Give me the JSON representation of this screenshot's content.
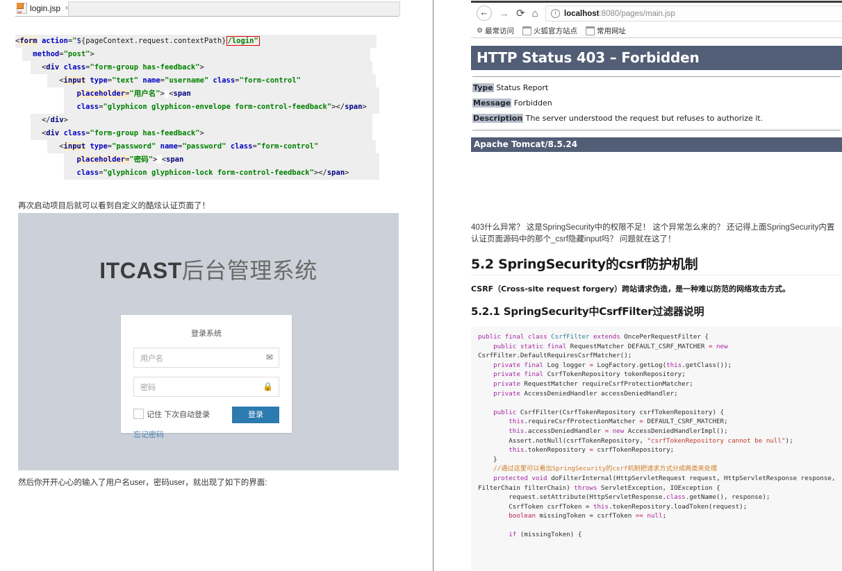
{
  "left": {
    "editor_tab": {
      "icon": "jsp-file-icon",
      "label": "login.jsp",
      "close": "×"
    },
    "jsp_code": {
      "lines": [
        {
          "indent": 0,
          "parts": [
            {
              "t": "<",
              "c": "pl"
            },
            {
              "t": "form",
              "c": "k hl"
            },
            {
              "t": " ",
              "c": "pl"
            },
            {
              "t": "action",
              "c": "at"
            },
            {
              "t": "=",
              "c": "pl"
            },
            {
              "t": "\"",
              "c": "st"
            },
            {
              "t": "$",
              "c": "el"
            },
            {
              "t": "{pageContext.request.contextPath}",
              "c": "pl"
            },
            {
              "t": "/login\"",
              "c": "st boxed"
            }
          ]
        },
        {
          "indent": 2,
          "parts": [
            {
              "t": "method",
              "c": "at"
            },
            {
              "t": "=",
              "c": "pl"
            },
            {
              "t": "\"post\"",
              "c": "st"
            },
            {
              "t": ">",
              "c": "pl"
            }
          ]
        },
        {
          "indent": 3,
          "parts": [
            {
              "t": "<",
              "c": "pl"
            },
            {
              "t": "div",
              "c": "k"
            },
            {
              "t": " ",
              "c": "pl"
            },
            {
              "t": "class",
              "c": "at"
            },
            {
              "t": "=",
              "c": "pl"
            },
            {
              "t": "\"form-group has-feedback\"",
              "c": "st"
            },
            {
              "t": ">",
              "c": "pl"
            }
          ]
        },
        {
          "indent": 5,
          "parts": [
            {
              "t": "<",
              "c": "pl"
            },
            {
              "t": "input",
              "c": "k hl"
            },
            {
              "t": " ",
              "c": "pl"
            },
            {
              "t": "type",
              "c": "at"
            },
            {
              "t": "=",
              "c": "pl"
            },
            {
              "t": "\"text\"",
              "c": "st"
            },
            {
              "t": " ",
              "c": "pl"
            },
            {
              "t": "name",
              "c": "at"
            },
            {
              "t": "=",
              "c": "pl"
            },
            {
              "t": "\"username\"",
              "c": "st"
            },
            {
              "t": " ",
              "c": "pl"
            },
            {
              "t": "class",
              "c": "at"
            },
            {
              "t": "=",
              "c": "pl"
            },
            {
              "t": "\"form-control\"",
              "c": "st"
            }
          ]
        },
        {
          "indent": 7,
          "parts": [
            {
              "t": "placeholder",
              "c": "at hl"
            },
            {
              "t": "=",
              "c": "pl hl"
            },
            {
              "t": "\"用户名\"",
              "c": "st"
            },
            {
              "t": ">",
              "c": "pl"
            },
            {
              "t": " ",
              "c": "pl hl2"
            },
            {
              "t": "<",
              "c": "pl"
            },
            {
              "t": "span",
              "c": "k"
            }
          ]
        },
        {
          "indent": 7,
          "parts": [
            {
              "t": "class",
              "c": "at"
            },
            {
              "t": "=",
              "c": "pl"
            },
            {
              "t": "\"glyphicon glyphicon-envelope form-control-feedback\"",
              "c": "st"
            },
            {
              "t": "></",
              "c": "pl"
            },
            {
              "t": "span",
              "c": "k"
            },
            {
              "t": ">",
              "c": "pl"
            }
          ]
        },
        {
          "indent": 3,
          "parts": [
            {
              "t": "</",
              "c": "pl"
            },
            {
              "t": "div",
              "c": "k"
            },
            {
              "t": ">",
              "c": "pl"
            }
          ]
        },
        {
          "indent": 3,
          "parts": [
            {
              "t": "<",
              "c": "pl"
            },
            {
              "t": "div",
              "c": "k"
            },
            {
              "t": " ",
              "c": "pl"
            },
            {
              "t": "class",
              "c": "at"
            },
            {
              "t": "=",
              "c": "pl"
            },
            {
              "t": "\"form-group has-feedback\"",
              "c": "st"
            },
            {
              "t": ">",
              "c": "pl"
            }
          ]
        },
        {
          "indent": 5,
          "parts": [
            {
              "t": "<",
              "c": "pl"
            },
            {
              "t": "input",
              "c": "k hl"
            },
            {
              "t": " ",
              "c": "pl"
            },
            {
              "t": "type",
              "c": "at"
            },
            {
              "t": "=",
              "c": "pl"
            },
            {
              "t": "\"password\"",
              "c": "st"
            },
            {
              "t": " ",
              "c": "pl"
            },
            {
              "t": "name",
              "c": "at"
            },
            {
              "t": "=",
              "c": "pl"
            },
            {
              "t": "\"password\"",
              "c": "st"
            },
            {
              "t": " ",
              "c": "pl"
            },
            {
              "t": "class",
              "c": "at"
            },
            {
              "t": "=",
              "c": "pl"
            },
            {
              "t": "\"form-control\"",
              "c": "st"
            }
          ]
        },
        {
          "indent": 7,
          "parts": [
            {
              "t": "placeholder",
              "c": "at hl"
            },
            {
              "t": "=",
              "c": "pl hl"
            },
            {
              "t": "\"密码\"",
              "c": "st"
            },
            {
              "t": ">",
              "c": "pl"
            },
            {
              "t": " ",
              "c": "pl hl2"
            },
            {
              "t": "<",
              "c": "pl"
            },
            {
              "t": "span",
              "c": "k"
            }
          ]
        },
        {
          "indent": 7,
          "parts": [
            {
              "t": "class",
              "c": "at"
            },
            {
              "t": "=",
              "c": "pl"
            },
            {
              "t": "\"glyphicon glyphicon-lock form-control-feedback\"",
              "c": "st"
            },
            {
              "t": "></",
              "c": "pl"
            },
            {
              "t": "span",
              "c": "k"
            },
            {
              "t": ">",
              "c": "pl"
            }
          ]
        }
      ]
    },
    "caption_1": "再次启动项目后就可以看到自定义的酷炫认证页面了！",
    "caption_2": "然后你开开心心的输入了用户名user，密码user，就出现了如下的界面:",
    "login_shot": {
      "brand_bold": "ITCAST",
      "brand_rest": "后台管理系统",
      "card_heading": "登录系统",
      "username_placeholder": "用户名",
      "username_icon": "envelope-icon",
      "username_glyph": "✉",
      "password_placeholder": "密码",
      "password_icon": "lock-icon",
      "password_glyph": "ὑ2",
      "remember_label": "记住 下次自动登录",
      "submit_label": "登录",
      "forgot_label": "忘记密码",
      "accent_color": "#2b7bb0",
      "background_color": "#ccd1d9"
    }
  },
  "right": {
    "browser": {
      "back_icon": "back-arrow-icon",
      "back_glyph": "←",
      "forward_icon": "forward-arrow-icon",
      "forward_glyph": "→",
      "reload_icon": "reload-icon",
      "reload_glyph": "⟳",
      "home_icon": "home-icon",
      "home_glyph": "⌂",
      "info_icon": "info-icon",
      "info_glyph": "i",
      "url_host": "localhost",
      "url_rest": ":8080/pages/main.jsp",
      "bookmarks": [
        {
          "icon": "star-icon",
          "glyph": "⚙",
          "label": "最常访问"
        },
        {
          "icon": "folder-icon",
          "glyph": "",
          "label": "火狐官方站点"
        },
        {
          "icon": "folder-icon",
          "glyph": "",
          "label": "常用网址"
        }
      ]
    },
    "tomcat": {
      "title": "HTTP Status 403 – Forbidden",
      "rows": [
        {
          "label": "Type",
          "value": "Status Report"
        },
        {
          "label": "Message",
          "value": "Forbidden"
        },
        {
          "label": "Description",
          "value": "The server understood the request but refuses to authorize it."
        }
      ],
      "footer": "Apache Tomcat/8.5.24",
      "band_color": "#525D76"
    },
    "paragraph_1": "403什么异常？ 这是SpringSecurity中的权限不足！ 这个异常怎么来的？ 还记得上面SpringSecurity内置认证页面源码中的那个_csrf隐藏input吗？ 问题就在这了！",
    "heading_52": "5.2 SpringSecurity的csrf防护机制",
    "bold_note": "CSRF（Cross-site request forgery）跨站请求伪造，是一种难以防范的网络攻击方式。",
    "heading_521": "5.2.1 SpringSecurity中CsrfFilter过滤器说明",
    "java_code_lines": [
      [
        {
          "t": "public ",
          "c": "j-kw"
        },
        {
          "t": "final ",
          "c": "j-kw"
        },
        {
          "t": "class ",
          "c": "j-kw"
        },
        {
          "t": "CsrfFilter",
          "c": "j-cls"
        },
        {
          "t": " extends ",
          "c": "j-kw"
        },
        {
          "t": "OncePerRequestFilter {",
          "c": "j-plain"
        }
      ],
      [
        {
          "t": "    public ",
          "c": "j-kw"
        },
        {
          "t": "static ",
          "c": "j-kw"
        },
        {
          "t": "final ",
          "c": "j-kw"
        },
        {
          "t": "RequestMatcher DEFAULT_CSRF_MATCHER ",
          "c": "j-plain"
        },
        {
          "t": "= ",
          "c": "j-ty"
        },
        {
          "t": "new",
          "c": "j-kw"
        }
      ],
      [
        {
          "t": "CsrfFilter.DefaultRequiresCsrfMatcher();",
          "c": "j-plain"
        }
      ],
      [
        {
          "t": "    private ",
          "c": "j-kw"
        },
        {
          "t": "final ",
          "c": "j-kw"
        },
        {
          "t": "Log logger ",
          "c": "j-plain"
        },
        {
          "t": "= ",
          "c": "j-ty"
        },
        {
          "t": "LogFactory.getLog(",
          "c": "j-plain"
        },
        {
          "t": "this",
          "c": "j-kw"
        },
        {
          "t": ".getClass());",
          "c": "j-plain"
        }
      ],
      [
        {
          "t": "    private ",
          "c": "j-kw"
        },
        {
          "t": "final ",
          "c": "j-kw"
        },
        {
          "t": "CsrfTokenRepository tokenRepository;",
          "c": "j-plain"
        }
      ],
      [
        {
          "t": "    private ",
          "c": "j-kw"
        },
        {
          "t": "RequestMatcher requireCsrfProtectionMatcher;",
          "c": "j-plain"
        }
      ],
      [
        {
          "t": "    private ",
          "c": "j-kw"
        },
        {
          "t": "AccessDeniedHandler accessDeniedHandler;",
          "c": "j-plain"
        }
      ],
      [
        {
          "t": "",
          "c": "j-plain"
        }
      ],
      [
        {
          "t": "    public ",
          "c": "j-kw"
        },
        {
          "t": "CsrfFilter(CsrfTokenRepository csrfTokenRepository) {",
          "c": "j-plain"
        }
      ],
      [
        {
          "t": "        this",
          "c": "j-kw"
        },
        {
          "t": ".requireCsrfProtectionMatcher ",
          "c": "j-plain"
        },
        {
          "t": "= ",
          "c": "j-ty"
        },
        {
          "t": "DEFAULT_CSRF_MATCHER;",
          "c": "j-plain"
        }
      ],
      [
        {
          "t": "        this",
          "c": "j-kw"
        },
        {
          "t": ".accessDeniedHandler ",
          "c": "j-plain"
        },
        {
          "t": "= ",
          "c": "j-ty"
        },
        {
          "t": "new ",
          "c": "j-kw"
        },
        {
          "t": "AccessDeniedHandlerImpl();",
          "c": "j-plain"
        }
      ],
      [
        {
          "t": "        Assert.notNull(csrfTokenRepository, ",
          "c": "j-plain"
        },
        {
          "t": "\"csrfTokenRepository cannot be null\"",
          "c": "j-str"
        },
        {
          "t": ");",
          "c": "j-plain"
        }
      ],
      [
        {
          "t": "        this",
          "c": "j-kw"
        },
        {
          "t": ".tokenRepository ",
          "c": "j-plain"
        },
        {
          "t": "= ",
          "c": "j-ty"
        },
        {
          "t": "csrfTokenRepository;",
          "c": "j-plain"
        }
      ],
      [
        {
          "t": "    }",
          "c": "j-plain"
        }
      ],
      [
        {
          "t": "    //通过这里可以看出SpringSecurity的csrf机制把请求方式分成两类来处理",
          "c": "j-cmt"
        }
      ],
      [
        {
          "t": "    protected ",
          "c": "j-kw"
        },
        {
          "t": "void ",
          "c": "j-kw"
        },
        {
          "t": "doFilterInternal(HttpServletRequest request, HttpServletResponse response,",
          "c": "j-plain"
        }
      ],
      [
        {
          "t": "FilterChain filterChain) ",
          "c": "j-plain"
        },
        {
          "t": "throws ",
          "c": "j-kw"
        },
        {
          "t": "ServletException, IOException {",
          "c": "j-plain"
        }
      ],
      [
        {
          "t": "        request.setAttribute(HttpServletResponse.",
          "c": "j-plain"
        },
        {
          "t": "class",
          "c": "j-kw"
        },
        {
          "t": ".getName(), response);",
          "c": "j-plain"
        }
      ],
      [
        {
          "t": "        CsrfToken csrfToken = ",
          "c": "j-plain"
        },
        {
          "t": "this",
          "c": "j-kw"
        },
        {
          "t": ".tokenRepository.loadToken(request);",
          "c": "j-plain"
        }
      ],
      [
        {
          "t": "        boolean ",
          "c": "j-ty"
        },
        {
          "t": "missingToken = csrfToken ",
          "c": "j-plain"
        },
        {
          "t": "== ",
          "c": "j-ty"
        },
        {
          "t": "null",
          "c": "j-kw"
        },
        {
          "t": ";",
          "c": "j-plain"
        }
      ],
      [
        {
          "t": "",
          "c": "j-plain"
        }
      ],
      [
        {
          "t": "        if ",
          "c": "j-kw"
        },
        {
          "t": "(missingToken) {",
          "c": "j-plain"
        }
      ]
    ]
  }
}
